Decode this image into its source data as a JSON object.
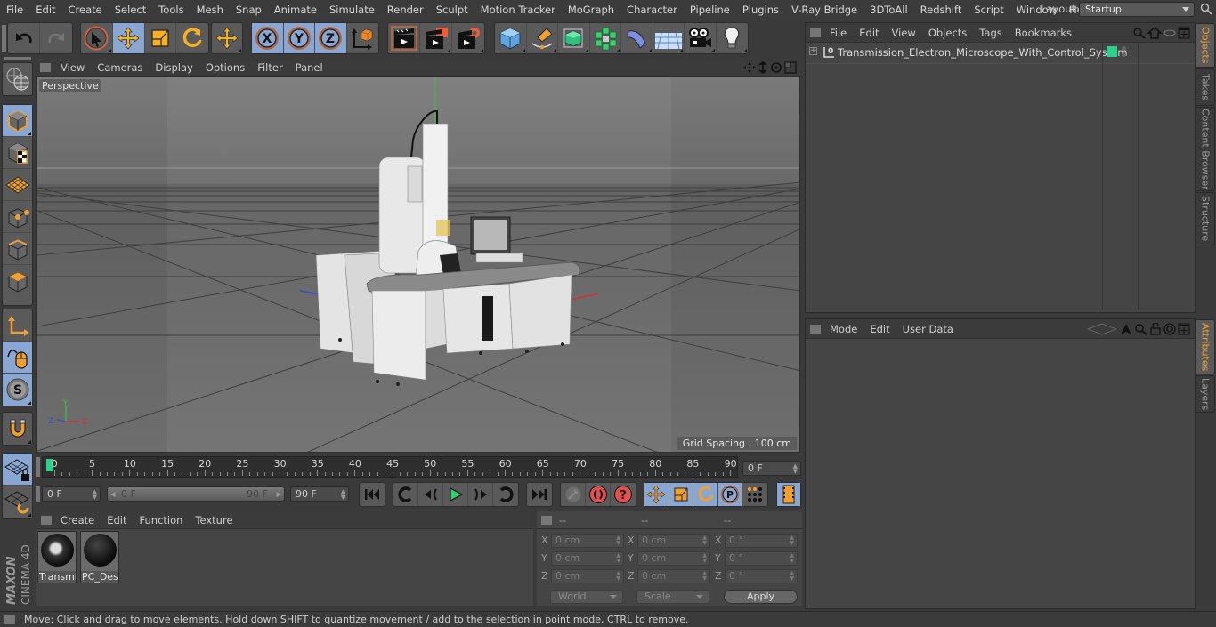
{
  "menubar": {
    "items": [
      "File",
      "Edit",
      "Create",
      "Select",
      "Tools",
      "Mesh",
      "Snap",
      "Animate",
      "Simulate",
      "Render",
      "Sculpt",
      "Motion Tracker",
      "MoGraph",
      "Character",
      "Pipeline",
      "Plugins",
      "V-Ray Bridge",
      "3DToAll",
      "Redshift",
      "Script",
      "Window",
      "Help"
    ],
    "layout_label": "Layout:",
    "layout_value": "Startup"
  },
  "toolbar": {
    "groups": [
      [
        "undo-icon",
        "redo-icon"
      ],
      [
        "live-selection-icon",
        "move-icon",
        "scale-icon",
        "rotate-icon"
      ],
      [
        "recent-tool-move-icon"
      ],
      [
        "x-axis-lock-icon",
        "y-axis-lock-icon",
        "z-axis-lock-icon",
        "coordinate-system-icon"
      ],
      [
        "render-view-icon",
        "render-to-picture-viewer-icon",
        "render-settings-icon"
      ],
      [
        "cube-primitive-icon",
        "pen-spline-icon",
        "subdivision-surface-icon",
        "cloner-icon",
        "deformer-bend-icon",
        "floor-environment-icon",
        "camera-icon",
        "light-icon"
      ]
    ]
  },
  "left_toolbar": {
    "items": [
      "make-editable-icon",
      "model-mode-icon",
      "texture-mode-icon",
      "workplane-mode-icon",
      "points-mode-icon",
      "edges-mode-icon",
      "polygons-mode-icon",
      "axis-mode-icon",
      "tweak-mode-icon",
      "solo-mode-icon",
      "snap-magnet-icon",
      "workplane-lock-icon",
      "workplane-rotate-icon"
    ]
  },
  "viewport": {
    "menu": [
      "View",
      "Cameras",
      "Display",
      "Options",
      "Filter",
      "Panel"
    ],
    "camera_label": "Perspective",
    "grid_spacing": "Grid Spacing : 100 cm",
    "axis_labels": {
      "x": "X",
      "y": "Y",
      "z": "Z"
    },
    "nav_icons": [
      "pan-icon",
      "zoom-icon",
      "orbit-icon",
      "maximize-view-icon"
    ]
  },
  "timeline": {
    "ticks": [
      "0",
      "5",
      "10",
      "15",
      "20",
      "25",
      "30",
      "35",
      "40",
      "45",
      "50",
      "55",
      "60",
      "65",
      "70",
      "75",
      "80",
      "85",
      "90"
    ],
    "current_frame_label": "0 F",
    "start_frame": "0 F",
    "range_start": "0 F",
    "range_end": "90 F",
    "end_frame": "90 F",
    "current_position_fraction": 0.0
  },
  "playback": {
    "buttons": [
      "go-to-start-icon",
      "previous-key-icon",
      "play-backwards-step-icon",
      "play-icon",
      "step-forward-icon",
      "next-key-icon",
      "go-to-end-icon"
    ],
    "key_buttons": [
      "record-disabled-icon",
      "autokey-icon",
      "keyframe-selection-icon"
    ],
    "param_buttons": [
      "record-position-icon",
      "record-scale-icon",
      "record-rotation-icon",
      "record-parameter-icon",
      "point-level-animation-icon"
    ],
    "timeline_button": "timeline-window-icon"
  },
  "materials": {
    "menu": [
      "Create",
      "Edit",
      "Function",
      "Texture"
    ],
    "items": [
      {
        "label": "Transmi"
      },
      {
        "label": "PC_Desk"
      }
    ]
  },
  "coordinates": {
    "headers": [
      "--",
      "--",
      "--"
    ],
    "rows": [
      {
        "axis": "X",
        "pos": "0 cm",
        "size": "0 cm",
        "rot": "0 °"
      },
      {
        "axis": "Y",
        "pos": "0 cm",
        "size": "0 cm",
        "rot": "0 °"
      },
      {
        "axis": "Z",
        "pos": "0 cm",
        "size": "0 cm",
        "rot": "0 °"
      }
    ],
    "mode_select": "World",
    "size_select": "Scale",
    "apply_label": "Apply"
  },
  "objects_panel": {
    "menu": [
      "File",
      "Edit",
      "View",
      "Objects",
      "Tags",
      "Bookmarks"
    ],
    "objects": [
      {
        "name": "Transmission_Electron_Microscope_With_Control_System",
        "layer_color": "#2ed08e"
      }
    ]
  },
  "attributes_panel": {
    "menu": [
      "Mode",
      "Edit",
      "User Data"
    ]
  },
  "side_tabs_top": [
    {
      "label": "Objects",
      "active": true
    },
    {
      "label": "Takes",
      "active": false
    },
    {
      "label": "Content Browser",
      "active": false
    },
    {
      "label": "Structure",
      "active": false
    }
  ],
  "side_tabs_bottom": [
    {
      "label": "Attributes",
      "active": true
    },
    {
      "label": "Layers",
      "active": false
    }
  ],
  "status": {
    "text": "Move: Click and drag to move elements. Hold down SHIFT to quantize movement / add to the selection in point mode, CTRL to remove."
  },
  "brand": {
    "maxon": "MAXON",
    "product": "CINEMA 4D"
  },
  "colors": {
    "accent_selected": "#8aa7d3",
    "active_tab": "#f0a030",
    "current_frame": "#2ed08e"
  }
}
